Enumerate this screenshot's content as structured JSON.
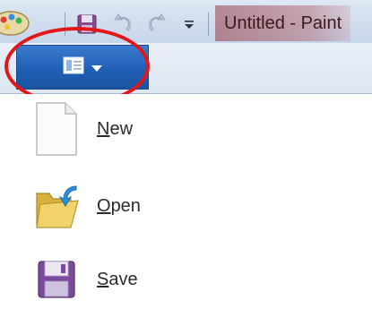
{
  "window": {
    "title": "Untitled - Paint"
  },
  "quick_access_toolbar": {
    "icons": [
      "paint-app-icon",
      "save-icon",
      "undo-icon",
      "redo-icon",
      "customize-dropdown-icon"
    ]
  },
  "app_menu_button": {
    "icon": "paint-menu-icon",
    "dropdown_icon": "chevron-down-icon"
  },
  "annotation": {
    "shape": "red-ellipse",
    "color": "#e01818"
  },
  "menu": {
    "items": [
      {
        "id": "new",
        "mnemonic": "N",
        "rest": "ew",
        "icon": "new-document-icon"
      },
      {
        "id": "open",
        "mnemonic": "O",
        "rest": "pen",
        "icon": "folder-open-icon"
      },
      {
        "id": "save",
        "mnemonic": "S",
        "rest": "ave",
        "icon": "floppy-disk-icon"
      }
    ]
  },
  "colors": {
    "app_button": "#1f5fb5",
    "title_highlight": "#963c46",
    "annotation": "#e01818"
  }
}
